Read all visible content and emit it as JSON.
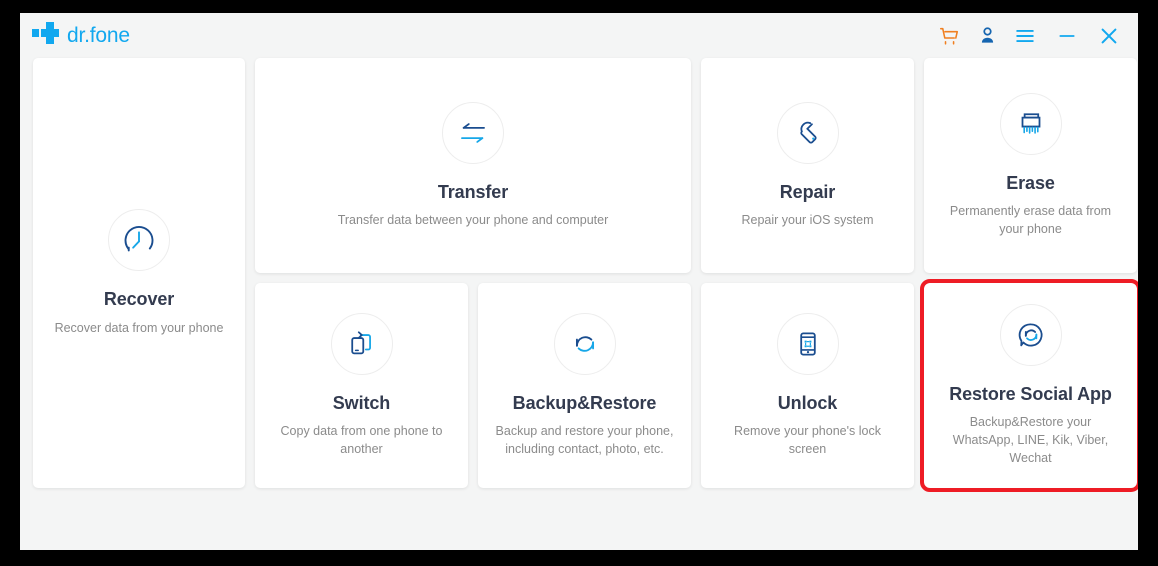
{
  "window": {
    "brand": "dr.fone",
    "brand_color": "#12a8ef",
    "background": "#f4f5f5",
    "card_background": "#ffffff",
    "selection_color": "#ee1c25"
  },
  "titlebar": {
    "actions": [
      {
        "name": "cart-icon",
        "label": "Cart",
        "color": "#f07f20"
      },
      {
        "name": "account-icon",
        "label": "Account",
        "color": "#1565b0"
      },
      {
        "name": "menu-icon",
        "label": "Menu",
        "color": "#12a8ef"
      },
      {
        "name": "minimize-icon",
        "label": "Minimize",
        "color": "#12a8ef"
      },
      {
        "name": "close-icon",
        "label": "Close",
        "color": "#12a8ef"
      }
    ]
  },
  "cards": {
    "recover": {
      "title": "Recover",
      "desc": "Recover data from your phone",
      "icon": "clock-recover-icon",
      "selected": false
    },
    "transfer": {
      "title": "Transfer",
      "desc": "Transfer data between your phone and computer",
      "icon": "transfer-arrows-icon",
      "selected": false
    },
    "repair": {
      "title": "Repair",
      "desc": "Repair your iOS system",
      "icon": "wrench-icon",
      "selected": false
    },
    "erase": {
      "title": "Erase",
      "desc": "Permanently erase data from your phone",
      "icon": "shredder-icon",
      "selected": false
    },
    "switch": {
      "title": "Switch",
      "desc": "Copy data from one phone to another",
      "icon": "phone-switch-icon",
      "selected": false
    },
    "backup_restore": {
      "title": "Backup&Restore",
      "desc": "Backup and restore your phone, including contact, photo, etc.",
      "icon": "refresh-circle-icon",
      "selected": false
    },
    "unlock": {
      "title": "Unlock",
      "desc": "Remove your phone's lock screen",
      "icon": "phone-lock-pattern-icon",
      "selected": false
    },
    "restore_social_app": {
      "title": "Restore Social App",
      "desc": "Backup&Restore your WhatsApp, LINE, Kik, Viber, Wechat",
      "icon": "chat-refresh-icon",
      "selected": true
    }
  }
}
